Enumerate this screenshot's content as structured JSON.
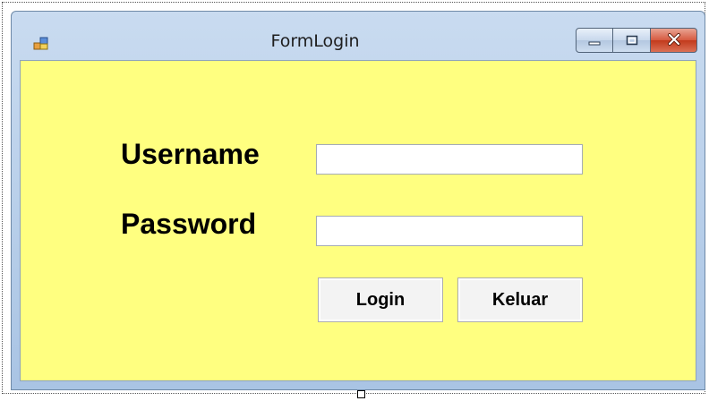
{
  "window": {
    "title": "FormLogin",
    "icons": {
      "app": "form-app-icon",
      "minimize": "minimize-icon",
      "maximize": "maximize-icon",
      "close": "close-icon"
    },
    "colors": {
      "client_background": "#ffff80",
      "close_button": "#c94b2e"
    }
  },
  "form": {
    "username_label": "Username",
    "username_value": "",
    "password_label": "Password",
    "password_value": "",
    "login_button": "Login",
    "exit_button": "Keluar"
  }
}
